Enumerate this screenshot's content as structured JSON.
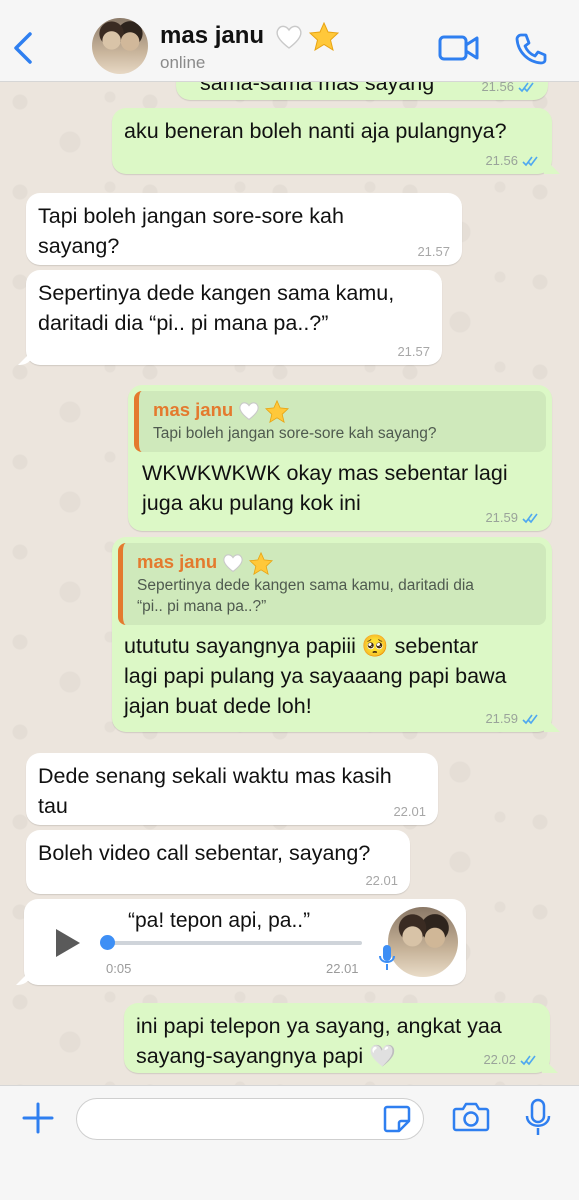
{
  "header": {
    "contact_name": "mas janu",
    "status": "online"
  },
  "messages": [
    {
      "id": "m0",
      "dir": "out",
      "text": "sama-sama mas sayang",
      "time": "21.56"
    },
    {
      "id": "m1",
      "dir": "out",
      "text": "aku beneran boleh nanti aja pulangnya?",
      "time": "21.56"
    },
    {
      "id": "m2",
      "dir": "in",
      "lines": [
        "Tapi boleh jangan sore-sore kah",
        "sayang?"
      ],
      "time": "21.57"
    },
    {
      "id": "m3",
      "dir": "in",
      "lines": [
        "Sepertinya dede kangen sama kamu,",
        "daritadi dia “pi.. pi mana pa..?”"
      ],
      "time": "21.57"
    },
    {
      "id": "m4",
      "dir": "out",
      "quote_name": "mas janu",
      "quote_lines": [
        "Tapi boleh jangan sore-sore kah sayang?"
      ],
      "lines": [
        "WKWKWKWK okay mas sebentar lagi",
        "juga aku pulang kok ini"
      ],
      "time": "21.59"
    },
    {
      "id": "m5",
      "dir": "out",
      "quote_name": "mas janu",
      "quote_lines": [
        "Sepertinya dede kangen sama kamu, daritadi dia",
        "“pi.. pi mana pa..?”"
      ],
      "lines": [
        "utututu sayangnya papiii 🥺 sebentar",
        "lagi papi pulang ya sayaaang papi bawa",
        "jajan buat dede loh!"
      ],
      "time": "21.59"
    },
    {
      "id": "m6",
      "dir": "in",
      "lines": [
        "Dede senang sekali waktu mas kasih",
        "tau"
      ],
      "time": "22.01"
    },
    {
      "id": "m7",
      "dir": "in",
      "lines": [
        "Boleh video call sebentar, sayang?"
      ],
      "time": "22.01"
    },
    {
      "id": "m9",
      "dir": "out",
      "lines": [
        "ini papi telepon ya sayang, angkat yaa",
        "sayang-sayangnya papi 🤍"
      ],
      "time": "22.02"
    }
  ],
  "voice_note": {
    "caption": "“pa! tepon api, pa..”",
    "duration": "0:05",
    "time": "22.01",
    "progress": 0.0
  },
  "footer": {
    "input_placeholder": ""
  },
  "colors": {
    "outgoing_bubble": "#dcf8c6",
    "incoming_bubble": "#ffffff",
    "accent_blue": "#3e8ff5",
    "quote_orange": "#e47a2e",
    "chat_background": "#ece5dd"
  },
  "icons": [
    "back-chevron-icon",
    "video-call-icon",
    "phone-icon",
    "white-heart-icon",
    "star-icon",
    "play-icon",
    "microphone-icon",
    "plus-icon",
    "sticker-icon",
    "camera-icon",
    "double-check-icon"
  ]
}
